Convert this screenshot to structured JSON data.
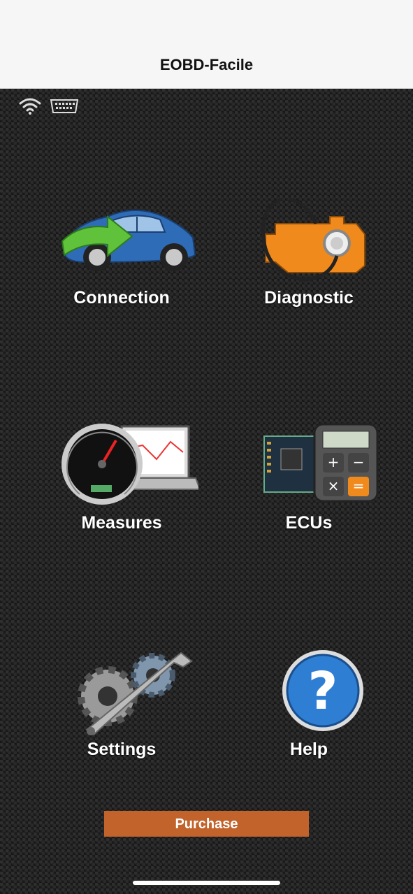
{
  "header": {
    "title": "EOBD-Facile"
  },
  "status": {
    "wifi_icon": "wifi-icon",
    "obd_icon": "obd-connector-icon"
  },
  "tiles": [
    {
      "label": "Connection",
      "icon": "car-connection-icon"
    },
    {
      "label": "Diagnostic",
      "icon": "engine-stethoscope-icon"
    },
    {
      "label": "Measures",
      "icon": "speedometer-laptop-icon"
    },
    {
      "label": "ECUs",
      "icon": "circuit-calculator-icon"
    },
    {
      "label": "Settings",
      "icon": "gears-wrench-icon"
    },
    {
      "label": "Help",
      "icon": "question-mark-icon"
    }
  ],
  "purchase": {
    "label": "Purchase"
  },
  "colors": {
    "purchase_bg": "#c2632c",
    "header_bg": "#f6f6f6",
    "background": "#1e1e1e"
  }
}
